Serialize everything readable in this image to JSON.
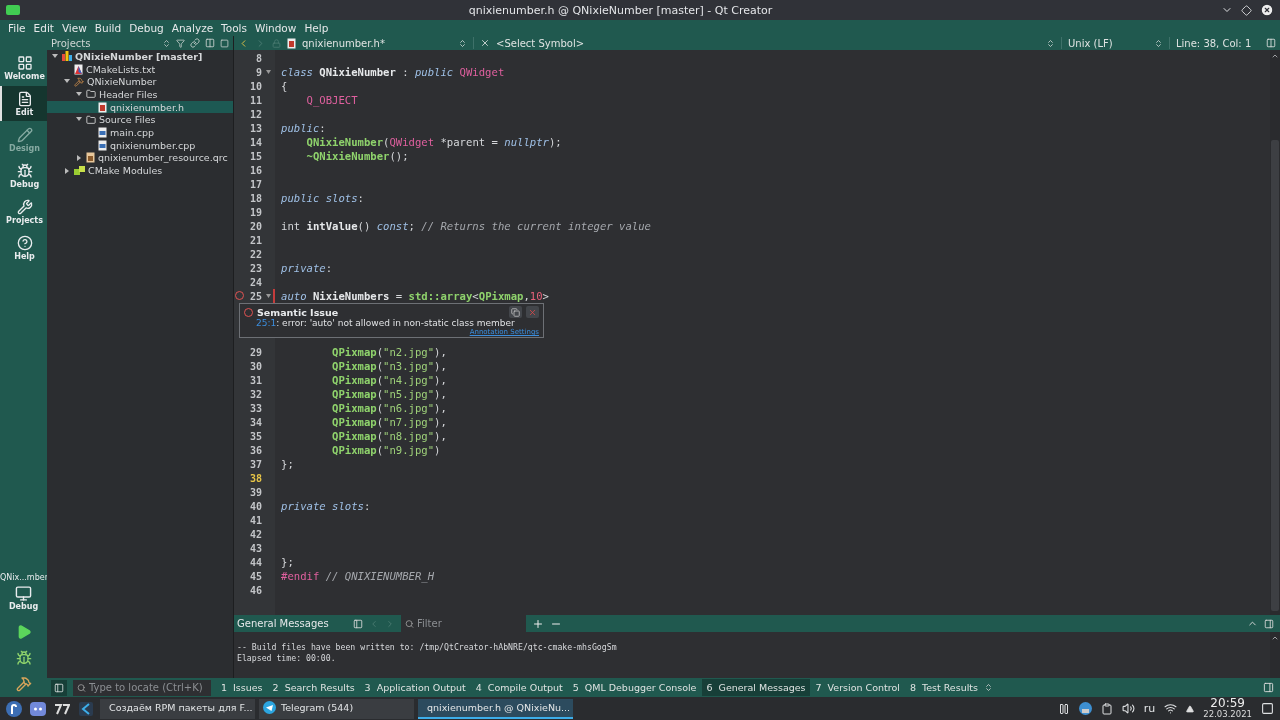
{
  "window": {
    "title": "qnixienumber.h @ QNixieNumber [master] - Qt Creator"
  },
  "menu": [
    "File",
    "Edit",
    "View",
    "Build",
    "Debug",
    "Analyze",
    "Tools",
    "Window",
    "Help"
  ],
  "modes": [
    {
      "kind": "welcome",
      "label": "Welcome",
      "selected": false,
      "disabled": false
    },
    {
      "kind": "edit",
      "label": "Edit",
      "selected": true,
      "disabled": false
    },
    {
      "kind": "design",
      "label": "Design",
      "selected": false,
      "disabled": true
    },
    {
      "kind": "debug",
      "label": "Debug",
      "selected": false,
      "disabled": false
    },
    {
      "kind": "projects",
      "label": "Projects",
      "selected": false,
      "disabled": false
    },
    {
      "kind": "help",
      "label": "Help",
      "selected": false,
      "disabled": false
    }
  ],
  "kit": {
    "project": "QNix...mber",
    "build": "Debug"
  },
  "projects_pane": {
    "title": "Projects",
    "tree": [
      {
        "kind": "project",
        "label": "QNixieNumber [master]",
        "expanded": true,
        "selected": false,
        "children": [
          {
            "kind": "cmake",
            "label": "CMakeLists.txt",
            "selected": false
          },
          {
            "kind": "target",
            "label": "QNixieNumber",
            "expanded": true,
            "selected": false,
            "children": [
              {
                "kind": "folder",
                "label": "Header Files",
                "expanded": true,
                "selected": false,
                "children": [
                  {
                    "kind": "header",
                    "label": "qnixienumber.h",
                    "selected": true
                  }
                ]
              },
              {
                "kind": "folder",
                "label": "Source Files",
                "expanded": true,
                "selected": false,
                "children": [
                  {
                    "kind": "source",
                    "label": "main.cpp",
                    "selected": false
                  },
                  {
                    "kind": "source",
                    "label": "qnixienumber.cpp",
                    "selected": false
                  }
                ]
              },
              {
                "kind": "resource",
                "label": "qnixienumber_resource.qrc",
                "expanded": false,
                "selected": false
              }
            ]
          },
          {
            "kind": "modules",
            "label": "CMake Modules",
            "expanded": false,
            "selected": false
          }
        ]
      }
    ]
  },
  "editor_toolbar": {
    "file": "qnixienumber.h*",
    "symbol": "<Select Symbol>",
    "line_ending": "Unix (LF)",
    "position": "Line: 38, Col: 1"
  },
  "code_top": [
    {
      "number": "8"
    },
    {
      "number": "9",
      "fold": true,
      "tokens": [
        {
          "kind": "keyword",
          "text": "class"
        },
        {
          "kind": "name",
          "text": " QNixieNumber"
        },
        {
          "kind": "plain",
          "text": " : "
        },
        {
          "kind": "keyword",
          "text": "public"
        },
        {
          "kind": "type",
          "text": " QWidget"
        }
      ]
    },
    {
      "number": "10",
      "tokens": [
        {
          "kind": "plain",
          "text": "{"
        }
      ]
    },
    {
      "number": "11",
      "tokens": [
        {
          "kind": "type",
          "text": "    Q_OBJECT"
        }
      ]
    },
    {
      "number": "12"
    },
    {
      "number": "13",
      "tokens": [
        {
          "kind": "keyword",
          "text": "public"
        },
        {
          "kind": "plain",
          "text": ":"
        }
      ]
    },
    {
      "number": "14",
      "tokens": [
        {
          "kind": "func",
          "text": "    QNixieNumber"
        },
        {
          "kind": "plain",
          "text": "("
        },
        {
          "kind": "type",
          "text": "QWidget"
        },
        {
          "kind": "plain",
          "text": " *parent = "
        },
        {
          "kind": "keyword",
          "text": "nullptr"
        },
        {
          "kind": "plain",
          "text": ");"
        }
      ]
    },
    {
      "number": "15",
      "tokens": [
        {
          "kind": "func",
          "text": "    ~QNixieNumber"
        },
        {
          "kind": "plain",
          "text": "();"
        }
      ]
    },
    {
      "number": "16"
    },
    {
      "number": "17"
    },
    {
      "number": "18",
      "tokens": [
        {
          "kind": "keyword",
          "text": "public slots"
        },
        {
          "kind": "plain",
          "text": ":"
        }
      ]
    },
    {
      "number": "19"
    },
    {
      "number": "20",
      "tokens": [
        {
          "kind": "plain",
          "text": "int "
        },
        {
          "kind": "name",
          "text": "intValue"
        },
        {
          "kind": "plain",
          "text": "() "
        },
        {
          "kind": "keyword",
          "text": "const"
        },
        {
          "kind": "plain",
          "text": "; "
        },
        {
          "kind": "comment",
          "text": "// Returns the current integer value"
        }
      ]
    },
    {
      "number": "21"
    },
    {
      "number": "22"
    },
    {
      "number": "23",
      "tokens": [
        {
          "kind": "keyword",
          "text": "private"
        },
        {
          "kind": "plain",
          "text": ":"
        }
      ]
    },
    {
      "number": "24"
    },
    {
      "number": "25",
      "fold": true,
      "error": true,
      "tokens": [
        {
          "kind": "keyword",
          "text": "auto"
        },
        {
          "kind": "name",
          "text": " NixieNumbers"
        },
        {
          "kind": "plain",
          "text": " = "
        },
        {
          "kind": "func",
          "text": "std::array"
        },
        {
          "kind": "plain",
          "text": "<"
        },
        {
          "kind": "func",
          "text": "QPixmap"
        },
        {
          "kind": "plain",
          "text": ","
        },
        {
          "kind": "number",
          "text": "10"
        },
        {
          "kind": "plain",
          "text": ">"
        }
      ]
    }
  ],
  "issue_tooltip": {
    "title": "Semantic Issue",
    "location": "25:1",
    "message": ": error: 'auto' not allowed in non-static class member",
    "link": "Annotation Settings"
  },
  "code_bottom": [
    {
      "number": "29",
      "tokens": [
        {
          "kind": "func",
          "text": "        QPixmap"
        },
        {
          "kind": "plain",
          "text": "("
        },
        {
          "kind": "string",
          "text": "\"n2.jpg\""
        },
        {
          "kind": "plain",
          "text": "),"
        }
      ]
    },
    {
      "number": "30",
      "tokens": [
        {
          "kind": "func",
          "text": "        QPixmap"
        },
        {
          "kind": "plain",
          "text": "("
        },
        {
          "kind": "string",
          "text": "\"n3.jpg\""
        },
        {
          "kind": "plain",
          "text": "),"
        }
      ]
    },
    {
      "number": "31",
      "tokens": [
        {
          "kind": "func",
          "text": "        QPixmap"
        },
        {
          "kind": "plain",
          "text": "("
        },
        {
          "kind": "string",
          "text": "\"n4.jpg\""
        },
        {
          "kind": "plain",
          "text": "),"
        }
      ]
    },
    {
      "number": "32",
      "tokens": [
        {
          "kind": "func",
          "text": "        QPixmap"
        },
        {
          "kind": "plain",
          "text": "("
        },
        {
          "kind": "string",
          "text": "\"n5.jpg\""
        },
        {
          "kind": "plain",
          "text": "),"
        }
      ]
    },
    {
      "number": "33",
      "tokens": [
        {
          "kind": "func",
          "text": "        QPixmap"
        },
        {
          "kind": "plain",
          "text": "("
        },
        {
          "kind": "string",
          "text": "\"n6.jpg\""
        },
        {
          "kind": "plain",
          "text": "),"
        }
      ]
    },
    {
      "number": "34",
      "tokens": [
        {
          "kind": "func",
          "text": "        QPixmap"
        },
        {
          "kind": "plain",
          "text": "("
        },
        {
          "kind": "string",
          "text": "\"n7.jpg\""
        },
        {
          "kind": "plain",
          "text": "),"
        }
      ]
    },
    {
      "number": "35",
      "tokens": [
        {
          "kind": "func",
          "text": "        QPixmap"
        },
        {
          "kind": "plain",
          "text": "("
        },
        {
          "kind": "string",
          "text": "\"n8.jpg\""
        },
        {
          "kind": "plain",
          "text": "),"
        }
      ]
    },
    {
      "number": "36",
      "tokens": [
        {
          "kind": "func",
          "text": "        QPixmap"
        },
        {
          "kind": "plain",
          "text": "("
        },
        {
          "kind": "string",
          "text": "\"n9.jpg\""
        },
        {
          "kind": "plain",
          "text": ")"
        }
      ]
    },
    {
      "number": "37",
      "tokens": [
        {
          "kind": "plain",
          "text": "};"
        }
      ]
    },
    {
      "number": "38",
      "current": true
    },
    {
      "number": "39"
    },
    {
      "number": "40",
      "tokens": [
        {
          "kind": "keyword",
          "text": "private slots"
        },
        {
          "kind": "plain",
          "text": ":"
        }
      ]
    },
    {
      "number": "41"
    },
    {
      "number": "42"
    },
    {
      "number": "43"
    },
    {
      "number": "44",
      "tokens": [
        {
          "kind": "plain",
          "text": "};"
        }
      ]
    },
    {
      "number": "45",
      "tokens": [
        {
          "kind": "macro",
          "text": "#endif"
        },
        {
          "kind": "comment",
          "text": " // QNIXIENUMBER_H"
        }
      ]
    },
    {
      "number": "46"
    }
  ],
  "output": {
    "title": "General Messages",
    "filter_placeholder": "Filter",
    "lines": [
      "-- Build files have been written to: /tmp/QtCreator-hAbNRE/qtc-cmake-mhsGogSm",
      "Elapsed time: 00:00."
    ]
  },
  "locator": {
    "placeholder": "Type to locate (Ctrl+K)"
  },
  "output_tabs": [
    {
      "number": "1",
      "label": "Issues",
      "selected": false
    },
    {
      "number": "2",
      "label": "Search Results",
      "selected": false
    },
    {
      "number": "3",
      "label": "Application Output",
      "selected": false
    },
    {
      "number": "4",
      "label": "Compile Output",
      "selected": false
    },
    {
      "number": "5",
      "label": "QML Debugger Console",
      "selected": false
    },
    {
      "number": "6",
      "label": "General Messages",
      "selected": true
    },
    {
      "number": "7",
      "label": "Version Control",
      "selected": false
    },
    {
      "number": "8",
      "label": "Test Results",
      "selected": false
    }
  ],
  "taskbar": {
    "tasks": [
      {
        "kind": "browser",
        "label": "Создаём RPM пакеты для F...",
        "selected": false
      },
      {
        "kind": "telegram",
        "label": "Telegram (544)",
        "selected": false
      },
      {
        "kind": "qt",
        "label": "qnixienumber.h @ QNixieNu...",
        "selected": true
      }
    ],
    "layout": "ru",
    "time": "20:59",
    "date": "22.03.2021"
  }
}
